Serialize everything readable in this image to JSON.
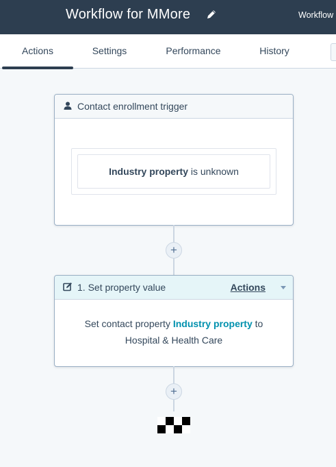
{
  "header": {
    "title": "Workflow for MMore",
    "right_label": "Workflow",
    "edit_icon": "pencil-icon"
  },
  "tabs": [
    {
      "label": "Actions",
      "active": true
    },
    {
      "label": "Settings",
      "active": false
    },
    {
      "label": "Performance",
      "active": false
    },
    {
      "label": "History",
      "active": false
    }
  ],
  "trigger": {
    "icon": "contact-person-icon",
    "title": "Contact enrollment trigger",
    "filter": {
      "property": "Industry property",
      "condition": "is unknown"
    }
  },
  "add_action_symbol": "+",
  "action": {
    "icon": "edit-property-icon",
    "title": "1. Set property value",
    "menu_label": "Actions",
    "body_prefix": "Set contact property",
    "property": "Industry property",
    "connector_word": "to",
    "value": "Hospital & Health Care"
  },
  "end_icon": "checkered-flag-icon",
  "colors": {
    "header_bg": "#2d3e50",
    "page_bg": "#f5f8fa",
    "action_header_bg": "#e5f5f8",
    "property_link": "#0091ae"
  }
}
